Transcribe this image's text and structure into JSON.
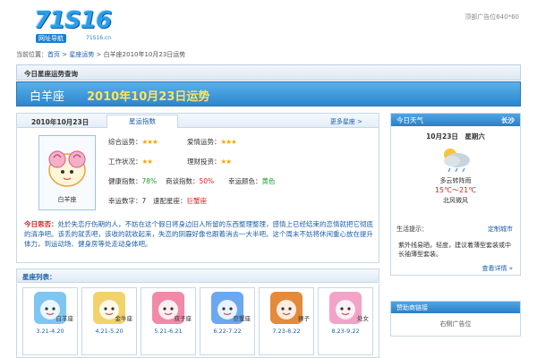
{
  "header": {
    "logo_text": "71S16",
    "logo_sub": "网址导航",
    "logo_domain": "71S16.cn",
    "ad_slot": "顶部广告位640*60"
  },
  "breadcrumb": {
    "prefix": "当前位置：",
    "home": "首页",
    "sep": " > ",
    "section": "星座运势",
    "page": "白羊座2010年10月23日运势"
  },
  "query_bar": {
    "title": "今日星座运势查询"
  },
  "banner": {
    "sign": "白羊座",
    "title": "2010年10月23日运势"
  },
  "fortune": {
    "date": "2010年10月23日",
    "tab": "星运指数",
    "more": "更多星座 >",
    "sign_label": "白羊座",
    "overall_label": "综合运势：",
    "overall_stars": "★★★",
    "love_label": "爱情运势：",
    "love_stars": "★★★",
    "work_label": "工作状况：",
    "work_stars": "★★",
    "finance_label": "理财投资：",
    "finance_stars": "★★",
    "health_label": "健康指数：",
    "health_value": "78%",
    "talk_label": "商谈指数：",
    "talk_value": "50%",
    "color_label": "幸运颜色：",
    "color_value": "黄色",
    "number_label": "幸运数字：",
    "number_value": "7",
    "match_label": "速配星座：",
    "match_value": "巨蟹座",
    "analysis_label": "今日思否：",
    "analysis_text": "处於失恋疗伤期的人，不妨在这个假日将身边旧人所留的东西整理整理，感情上已经结束的恋情就把它彻底的清净吧。该丢的就丢吧，该收的就收起来，失恋的阴霾好像也跟着消去一大半吧。这个周末不妨将休闲重心放在提升体力，到运动场、健身房等处走动身体吧。"
  },
  "weather": {
    "title": "今日天气",
    "city": "长沙",
    "date": "10月23日　星期六",
    "desc": "多云转阵雨",
    "temp": "15℃～21℃",
    "wind": "北风微风",
    "life_label": "生活提示：",
    "customize": "定制城市",
    "tip": "紫外线易晒，轻度，建议着薄型套装或中长袖薄型套装。",
    "more": "查看详情 »"
  },
  "zodiac_list": {
    "title": "星座列表：",
    "items": [
      {
        "name": "白羊座",
        "range": "3.21-4.20",
        "color": "#7fc6f2"
      },
      {
        "name": "金牛座",
        "range": "4.21-5.20",
        "color": "#f2d26b"
      },
      {
        "name": "双子座",
        "range": "5.21-6.21",
        "color": "#f08aa8"
      },
      {
        "name": "巨蟹座",
        "range": "6.22-7.22",
        "color": "#6aa8f2"
      },
      {
        "name": "狮子",
        "range": "7.23-8.22",
        "color": "#e48a3a"
      },
      {
        "name": "处女",
        "range": "8.23-9.22",
        "color": "#f2a3c8"
      }
    ]
  },
  "sponsor": {
    "title": "赞助商链接",
    "ad": "右侧广告位"
  }
}
